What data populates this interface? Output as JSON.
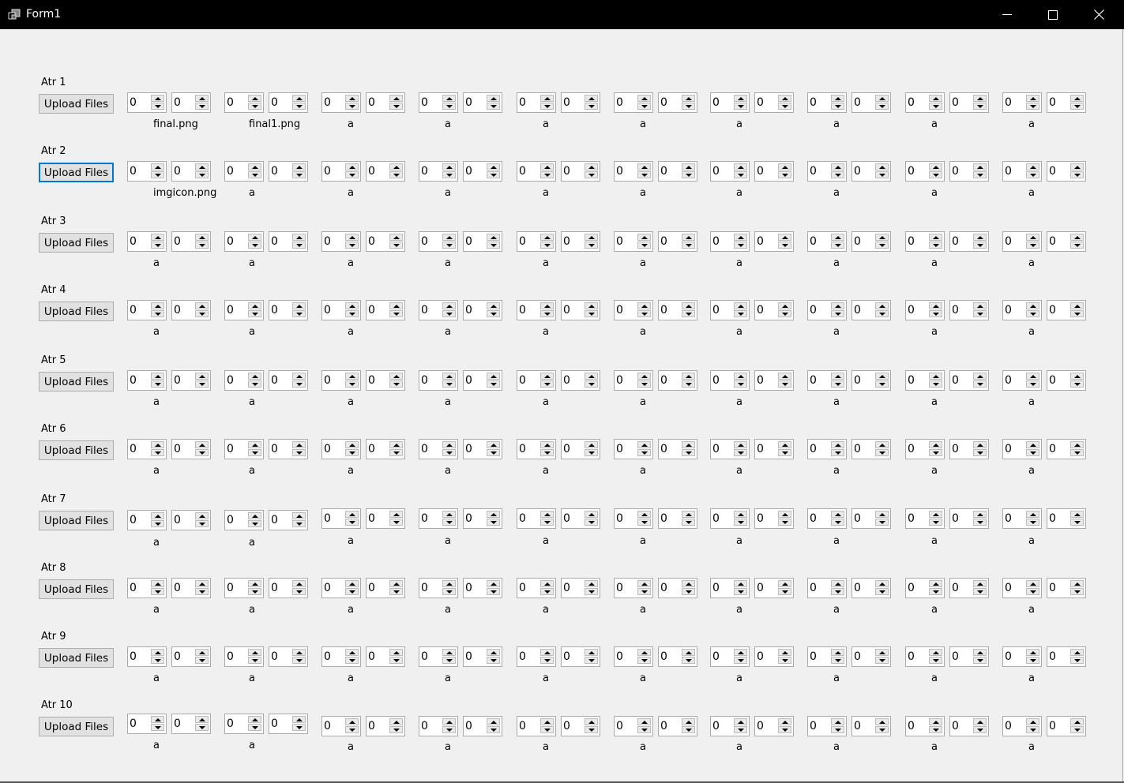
{
  "window": {
    "title": "Form1",
    "icons": {
      "app": "app-window-icon",
      "minimize": "minimize-icon",
      "maximize": "maximize-icon",
      "close": "close-icon"
    }
  },
  "form": {
    "upload_label": "Upload Files",
    "focused_row": 1,
    "rows": [
      {
        "label": "Atr 1",
        "groups": [
          {
            "a": "0",
            "b": "0",
            "file": "final.png"
          },
          {
            "a": "0",
            "b": "0",
            "file": "final1.png"
          },
          {
            "a": "0",
            "b": "0",
            "file": "a"
          },
          {
            "a": "0",
            "b": "0",
            "file": "a"
          },
          {
            "a": "0",
            "b": "0",
            "file": "a"
          },
          {
            "a": "0",
            "b": "0",
            "file": "a"
          },
          {
            "a": "0",
            "b": "0",
            "file": "a"
          },
          {
            "a": "0",
            "b": "0",
            "file": "a"
          },
          {
            "a": "0",
            "b": "0",
            "file": "a"
          },
          {
            "a": "0",
            "b": "0",
            "file": "a"
          }
        ]
      },
      {
        "label": "Atr 2",
        "groups": [
          {
            "a": "0",
            "b": "0",
            "file": "imgicon.png"
          },
          {
            "a": "0",
            "b": "0",
            "file": "a"
          },
          {
            "a": "0",
            "b": "0",
            "file": "a"
          },
          {
            "a": "0",
            "b": "0",
            "file": "a"
          },
          {
            "a": "0",
            "b": "0",
            "file": "a"
          },
          {
            "a": "0",
            "b": "0",
            "file": "a"
          },
          {
            "a": "0",
            "b": "0",
            "file": "a"
          },
          {
            "a": "0",
            "b": "0",
            "file": "a"
          },
          {
            "a": "0",
            "b": "0",
            "file": "a"
          },
          {
            "a": "0",
            "b": "0",
            "file": "a"
          }
        ]
      },
      {
        "label": "Atr 3",
        "groups": [
          {
            "a": "0",
            "b": "0",
            "file": "a"
          },
          {
            "a": "0",
            "b": "0",
            "file": "a"
          },
          {
            "a": "0",
            "b": "0",
            "file": "a"
          },
          {
            "a": "0",
            "b": "0",
            "file": "a"
          },
          {
            "a": "0",
            "b": "0",
            "file": "a"
          },
          {
            "a": "0",
            "b": "0",
            "file": "a"
          },
          {
            "a": "0",
            "b": "0",
            "file": "a"
          },
          {
            "a": "0",
            "b": "0",
            "file": "a"
          },
          {
            "a": "0",
            "b": "0",
            "file": "a"
          },
          {
            "a": "0",
            "b": "0",
            "file": "a"
          }
        ]
      },
      {
        "label": "Atr 4",
        "groups": [
          {
            "a": "0",
            "b": "0",
            "file": "a"
          },
          {
            "a": "0",
            "b": "0",
            "file": "a"
          },
          {
            "a": "0",
            "b": "0",
            "file": "a"
          },
          {
            "a": "0",
            "b": "0",
            "file": "a"
          },
          {
            "a": "0",
            "b": "0",
            "file": "a"
          },
          {
            "a": "0",
            "b": "0",
            "file": "a"
          },
          {
            "a": "0",
            "b": "0",
            "file": "a"
          },
          {
            "a": "0",
            "b": "0",
            "file": "a"
          },
          {
            "a": "0",
            "b": "0",
            "file": "a"
          },
          {
            "a": "0",
            "b": "0",
            "file": "a"
          }
        ]
      },
      {
        "label": "Atr 5",
        "groups": [
          {
            "a": "0",
            "b": "0",
            "file": "a"
          },
          {
            "a": "0",
            "b": "0",
            "file": "a"
          },
          {
            "a": "0",
            "b": "0",
            "file": "a"
          },
          {
            "a": "0",
            "b": "0",
            "file": "a"
          },
          {
            "a": "0",
            "b": "0",
            "file": "a"
          },
          {
            "a": "0",
            "b": "0",
            "file": "a"
          },
          {
            "a": "0",
            "b": "0",
            "file": "a"
          },
          {
            "a": "0",
            "b": "0",
            "file": "a"
          },
          {
            "a": "0",
            "b": "0",
            "file": "a"
          },
          {
            "a": "0",
            "b": "0",
            "file": "a"
          }
        ]
      },
      {
        "label": "Atr 6",
        "groups": [
          {
            "a": "0",
            "b": "0",
            "file": "a"
          },
          {
            "a": "0",
            "b": "0",
            "file": "a"
          },
          {
            "a": "0",
            "b": "0",
            "file": "a"
          },
          {
            "a": "0",
            "b": "0",
            "file": "a"
          },
          {
            "a": "0",
            "b": "0",
            "file": "a"
          },
          {
            "a": "0",
            "b": "0",
            "file": "a"
          },
          {
            "a": "0",
            "b": "0",
            "file": "a"
          },
          {
            "a": "0",
            "b": "0",
            "file": "a"
          },
          {
            "a": "0",
            "b": "0",
            "file": "a"
          },
          {
            "a": "0",
            "b": "0",
            "file": "a"
          }
        ]
      },
      {
        "label": "Atr 7",
        "groups": [
          {
            "a": "0",
            "b": "0",
            "file": "a"
          },
          {
            "a": "0",
            "b": "0",
            "file": "a"
          },
          {
            "a": "0",
            "b": "0",
            "file": "a"
          },
          {
            "a": "0",
            "b": "0",
            "file": "a"
          },
          {
            "a": "0",
            "b": "0",
            "file": "a"
          },
          {
            "a": "0",
            "b": "0",
            "file": "a"
          },
          {
            "a": "0",
            "b": "0",
            "file": "a"
          },
          {
            "a": "0",
            "b": "0",
            "file": "a"
          },
          {
            "a": "0",
            "b": "0",
            "file": "a"
          },
          {
            "a": "0",
            "b": "0",
            "file": "a"
          }
        ]
      },
      {
        "label": "Atr 8",
        "groups": [
          {
            "a": "0",
            "b": "0",
            "file": "a"
          },
          {
            "a": "0",
            "b": "0",
            "file": "a"
          },
          {
            "a": "0",
            "b": "0",
            "file": "a"
          },
          {
            "a": "0",
            "b": "0",
            "file": "a"
          },
          {
            "a": "0",
            "b": "0",
            "file": "a"
          },
          {
            "a": "0",
            "b": "0",
            "file": "a"
          },
          {
            "a": "0",
            "b": "0",
            "file": "a"
          },
          {
            "a": "0",
            "b": "0",
            "file": "a"
          },
          {
            "a": "0",
            "b": "0",
            "file": "a"
          },
          {
            "a": "0",
            "b": "0",
            "file": "a"
          }
        ]
      },
      {
        "label": "Atr 9",
        "groups": [
          {
            "a": "0",
            "b": "0",
            "file": "a"
          },
          {
            "a": "0",
            "b": "0",
            "file": "a"
          },
          {
            "a": "0",
            "b": "0",
            "file": "a"
          },
          {
            "a": "0",
            "b": "0",
            "file": "a"
          },
          {
            "a": "0",
            "b": "0",
            "file": "a"
          },
          {
            "a": "0",
            "b": "0",
            "file": "a"
          },
          {
            "a": "0",
            "b": "0",
            "file": "a"
          },
          {
            "a": "0",
            "b": "0",
            "file": "a"
          },
          {
            "a": "0",
            "b": "0",
            "file": "a"
          },
          {
            "a": "0",
            "b": "0",
            "file": "a"
          }
        ]
      },
      {
        "label": "Atr 10",
        "groups": [
          {
            "a": "0",
            "b": "0",
            "file": "a"
          },
          {
            "a": "0",
            "b": "0",
            "file": "a"
          },
          {
            "a": "0",
            "b": "0",
            "file": "a"
          },
          {
            "a": "0",
            "b": "0",
            "file": "a"
          },
          {
            "a": "0",
            "b": "0",
            "file": "a"
          },
          {
            "a": "0",
            "b": "0",
            "file": "a"
          },
          {
            "a": "0",
            "b": "0",
            "file": "a"
          },
          {
            "a": "0",
            "b": "0",
            "file": "a"
          },
          {
            "a": "0",
            "b": "0",
            "file": "a"
          },
          {
            "a": "0",
            "b": "0",
            "file": "a"
          }
        ]
      }
    ]
  }
}
